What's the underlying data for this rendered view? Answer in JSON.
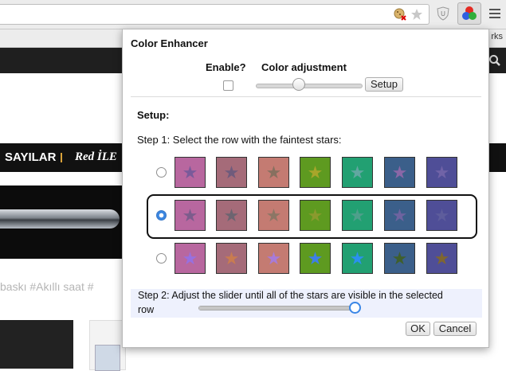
{
  "browser": {
    "bookmarks_text": "rks",
    "icons": [
      "cookie-blocked-icon",
      "bookmark-star-icon",
      "shield-icon",
      "color-enhancer-icon",
      "menu-icon"
    ]
  },
  "page": {
    "nav_icon": "search-icon",
    "categories": [
      "SAYILAR",
      "Red İLE"
    ],
    "tags": "baskı   #Akıllı saat   #"
  },
  "popup": {
    "title": "Color Enhancer",
    "enable_label": "Enable?",
    "enable_checked": false,
    "adjustment_label": "Color adjustment",
    "adjustment_level": 0.4,
    "setup_button": "Setup",
    "setup_heading": "Setup:",
    "step1": "Step 1: Select the row with the faintest stars:",
    "rows": [
      {
        "selected": false,
        "swatches": [
          {
            "bg": "#b8679f",
            "star": "#7a5a9a"
          },
          {
            "bg": "#a56b79",
            "star": "#6f5b7c"
          },
          {
            "bg": "#c47b72",
            "star": "#87705f"
          },
          {
            "bg": "#5e9a20",
            "star": "#a7a62a"
          },
          {
            "bg": "#22a072",
            "star": "#62a7a1"
          },
          {
            "bg": "#3b5f8a",
            "star": "#8a67a7"
          },
          {
            "bg": "#4f4e97",
            "star": "#7063a7"
          }
        ]
      },
      {
        "selected": true,
        "swatches": [
          {
            "bg": "#b8679f",
            "star": "#7c5c8c"
          },
          {
            "bg": "#a56b79",
            "star": "#6d6470"
          },
          {
            "bg": "#c47b72",
            "star": "#8c7665"
          },
          {
            "bg": "#5e9a20",
            "star": "#8a9a2e"
          },
          {
            "bg": "#22a072",
            "star": "#4e9f8b"
          },
          {
            "bg": "#3b5f8a",
            "star": "#6e63a0"
          },
          {
            "bg": "#4f4e97",
            "star": "#5e5d9c"
          }
        ]
      },
      {
        "selected": false,
        "swatches": [
          {
            "bg": "#b8679f",
            "star": "#9770e0"
          },
          {
            "bg": "#a56b79",
            "star": "#c97c50"
          },
          {
            "bg": "#c47b72",
            "star": "#a87bd8"
          },
          {
            "bg": "#5e9a20",
            "star": "#3d7fe8"
          },
          {
            "bg": "#22a072",
            "star": "#2a90f0"
          },
          {
            "bg": "#3b5f8a",
            "star": "#3f5f2c"
          },
          {
            "bg": "#4f4e97",
            "star": "#7f6630"
          }
        ]
      }
    ],
    "step2": "Step 2: Adjust the slider until all of the stars are visible in the selected",
    "step2_cont": "row",
    "step2_level": 0.97,
    "ok_button": "OK",
    "cancel_button": "Cancel"
  }
}
